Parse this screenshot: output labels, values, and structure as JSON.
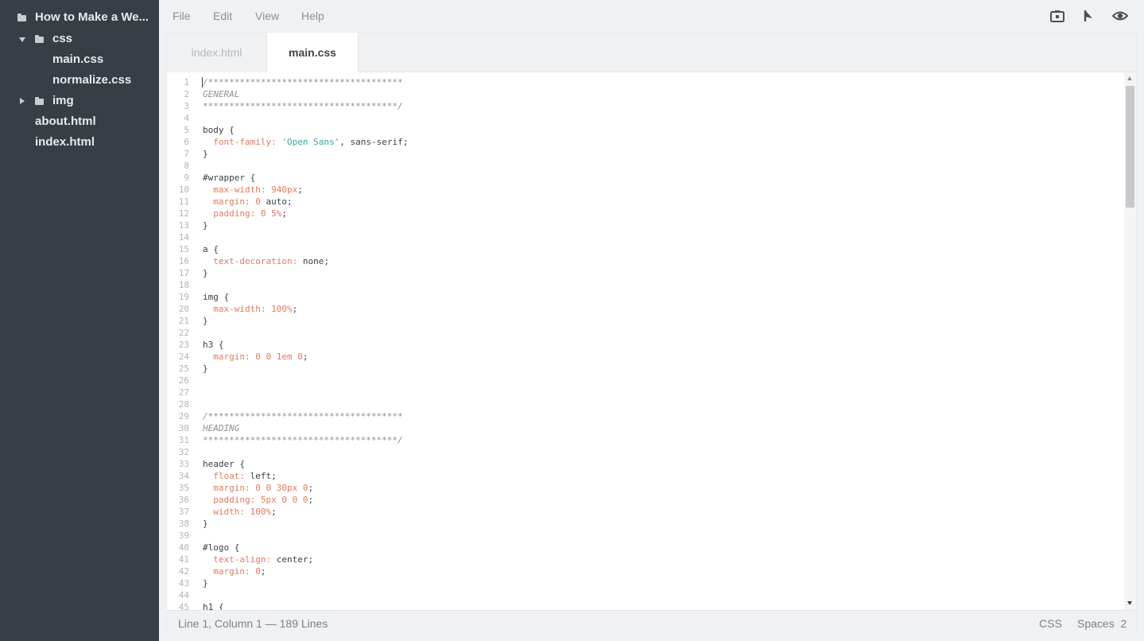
{
  "sidebar": {
    "project": "How to Make a We...",
    "items": [
      {
        "label": "css",
        "type": "folder",
        "expanded": true
      },
      {
        "label": "main.css",
        "type": "file"
      },
      {
        "label": "normalize.css",
        "type": "file"
      },
      {
        "label": "img",
        "type": "folder",
        "expanded": false
      },
      {
        "label": "about.html",
        "type": "file"
      },
      {
        "label": "index.html",
        "type": "file"
      }
    ]
  },
  "menu": [
    "File",
    "Edit",
    "View",
    "Help"
  ],
  "toolbar_icons": [
    "screenshot-icon",
    "share-icon",
    "preview-eye-icon"
  ],
  "tabs": [
    {
      "label": "index.html",
      "active": false
    },
    {
      "label": "main.css",
      "active": true
    }
  ],
  "editor": {
    "lines": [
      [
        [
          "comment",
          "/*************************************"
        ]
      ],
      [
        [
          "comment",
          "GENERAL"
        ]
      ],
      [
        [
          "comment",
          "*************************************/"
        ]
      ],
      [],
      [
        [
          "sel",
          "body {"
        ]
      ],
      [
        [
          "sp",
          "  "
        ],
        [
          "prop",
          "font-family:"
        ],
        [
          "sp",
          " "
        ],
        [
          "str",
          "'Open Sans'"
        ],
        [
          "punc",
          ", sans-serif;"
        ]
      ],
      [
        [
          "punc",
          "}"
        ]
      ],
      [],
      [
        [
          "sel",
          "#wrapper {"
        ]
      ],
      [
        [
          "sp",
          "  "
        ],
        [
          "prop",
          "max-width:"
        ],
        [
          "sp",
          " "
        ],
        [
          "num",
          "940px"
        ],
        [
          "punc",
          ";"
        ]
      ],
      [
        [
          "sp",
          "  "
        ],
        [
          "prop",
          "margin:"
        ],
        [
          "sp",
          " "
        ],
        [
          "num",
          "0"
        ],
        [
          "val",
          " auto;"
        ]
      ],
      [
        [
          "sp",
          "  "
        ],
        [
          "prop",
          "padding:"
        ],
        [
          "sp",
          " "
        ],
        [
          "num",
          "0 5%"
        ],
        [
          "punc",
          ";"
        ]
      ],
      [
        [
          "punc",
          "}"
        ]
      ],
      [],
      [
        [
          "sel",
          "a {"
        ]
      ],
      [
        [
          "sp",
          "  "
        ],
        [
          "prop",
          "text-decoration:"
        ],
        [
          "val",
          " none;"
        ]
      ],
      [
        [
          "punc",
          "}"
        ]
      ],
      [],
      [
        [
          "sel",
          "img {"
        ]
      ],
      [
        [
          "sp",
          "  "
        ],
        [
          "prop",
          "max-width:"
        ],
        [
          "sp",
          " "
        ],
        [
          "num",
          "100%"
        ],
        [
          "punc",
          ";"
        ]
      ],
      [
        [
          "punc",
          "}"
        ]
      ],
      [],
      [
        [
          "sel",
          "h3 {"
        ]
      ],
      [
        [
          "sp",
          "  "
        ],
        [
          "prop",
          "margin:"
        ],
        [
          "sp",
          " "
        ],
        [
          "num",
          "0 0 1em 0"
        ],
        [
          "punc",
          ";"
        ]
      ],
      [
        [
          "punc",
          "}"
        ]
      ],
      [],
      [],
      [],
      [
        [
          "comment",
          "/*************************************"
        ]
      ],
      [
        [
          "comment",
          "HEADING"
        ]
      ],
      [
        [
          "comment",
          "*************************************/"
        ]
      ],
      [],
      [
        [
          "sel",
          "header {"
        ]
      ],
      [
        [
          "sp",
          "  "
        ],
        [
          "prop",
          "float:"
        ],
        [
          "val",
          " left;"
        ]
      ],
      [
        [
          "sp",
          "  "
        ],
        [
          "prop",
          "margin:"
        ],
        [
          "sp",
          " "
        ],
        [
          "num",
          "0 0 30px 0"
        ],
        [
          "punc",
          ";"
        ]
      ],
      [
        [
          "sp",
          "  "
        ],
        [
          "prop",
          "padding:"
        ],
        [
          "sp",
          " "
        ],
        [
          "num",
          "5px 0 0 0"
        ],
        [
          "punc",
          ";"
        ]
      ],
      [
        [
          "sp",
          "  "
        ],
        [
          "prop",
          "width:"
        ],
        [
          "sp",
          " "
        ],
        [
          "num",
          "100%"
        ],
        [
          "punc",
          ";"
        ]
      ],
      [
        [
          "punc",
          "}"
        ]
      ],
      [],
      [
        [
          "sel",
          "#logo {"
        ]
      ],
      [
        [
          "sp",
          "  "
        ],
        [
          "prop",
          "text-align:"
        ],
        [
          "val",
          " center;"
        ]
      ],
      [
        [
          "sp",
          "  "
        ],
        [
          "prop",
          "margin:"
        ],
        [
          "sp",
          " "
        ],
        [
          "num",
          "0"
        ],
        [
          "punc",
          ";"
        ]
      ],
      [
        [
          "punc",
          "}"
        ]
      ],
      [],
      [
        [
          "sel",
          "h1 {"
        ]
      ]
    ]
  },
  "status": {
    "position": "Line 1, Column 1 — 189 Lines",
    "mode": "CSS",
    "indent": "Spaces  2"
  },
  "colors": {
    "sidebar_bg": "#383e45",
    "property": "#e07a5f",
    "string": "#3aa39a",
    "comment": "#8c9096"
  }
}
